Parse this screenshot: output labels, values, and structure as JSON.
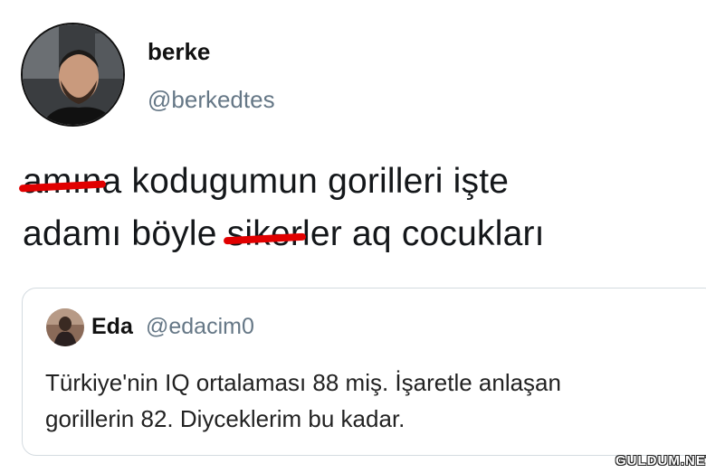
{
  "author": {
    "display_name": "berke",
    "handle": "@berkedtes",
    "avatar_icon": "person-avatar-icon"
  },
  "tweet": {
    "line1_censored": "amın",
    "line1_rest": "a kodugumun gorilleri işte",
    "line2_start": "adamı böyle ",
    "line2_censored": "siker",
    "line2_end": "ler aq cocukları",
    "censor_color": "#e10000"
  },
  "quoted_tweet": {
    "display_name": "Eda",
    "handle": "@edacim0",
    "text_line1": "Türkiye'nin IQ ortalaması 88 miş. İşaretle anlaşan",
    "text_line2": "gorillerin 82. Diyceklerim bu kadar.",
    "avatar_icon": "person-avatar-icon"
  },
  "watermark": "GULDUM.NET"
}
